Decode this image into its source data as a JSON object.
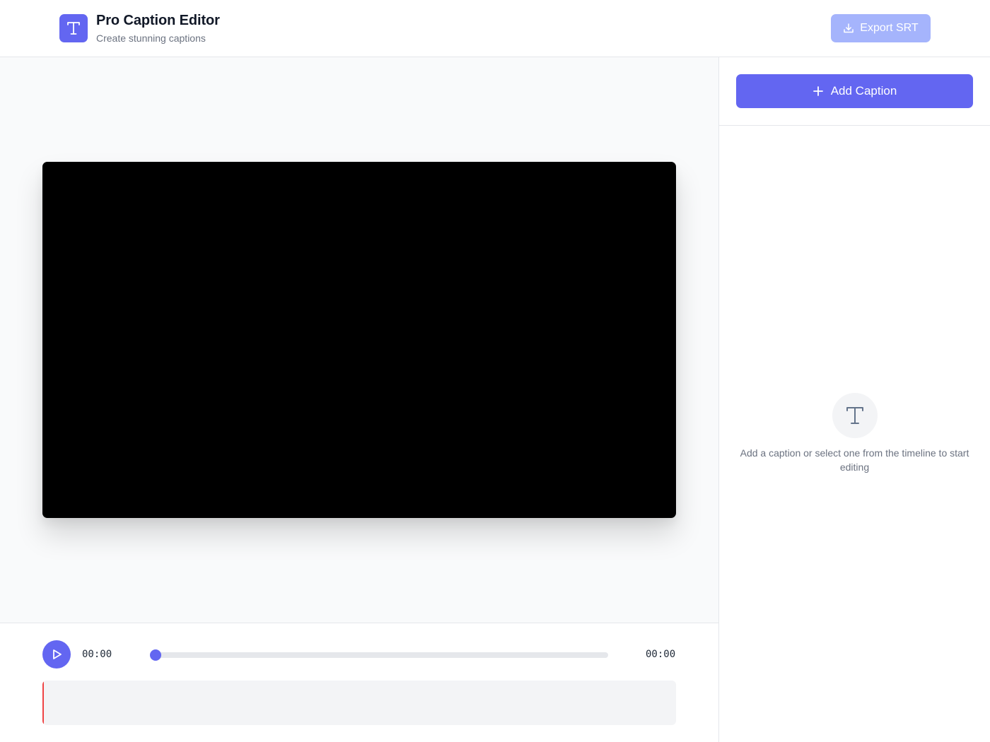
{
  "header": {
    "title": "Pro Caption Editor",
    "subtitle": "Create stunning captions",
    "logo_icon": "text-t-icon",
    "export_label": "Export SRT",
    "export_icon": "download-icon",
    "export_enabled": false
  },
  "player": {
    "current_time": "00:00",
    "total_time": "00:00",
    "progress_percent": 0,
    "play_icon": "play-icon"
  },
  "sidebar": {
    "add_caption_label": "Add Caption",
    "add_icon": "plus-icon",
    "empty_icon": "text-t-icon",
    "empty_message": "Add a caption or select one from the timeline to start editing"
  },
  "colors": {
    "accent": "#6366f1",
    "accent_disabled": "#a5b4fc",
    "playhead": "#ef4444"
  }
}
